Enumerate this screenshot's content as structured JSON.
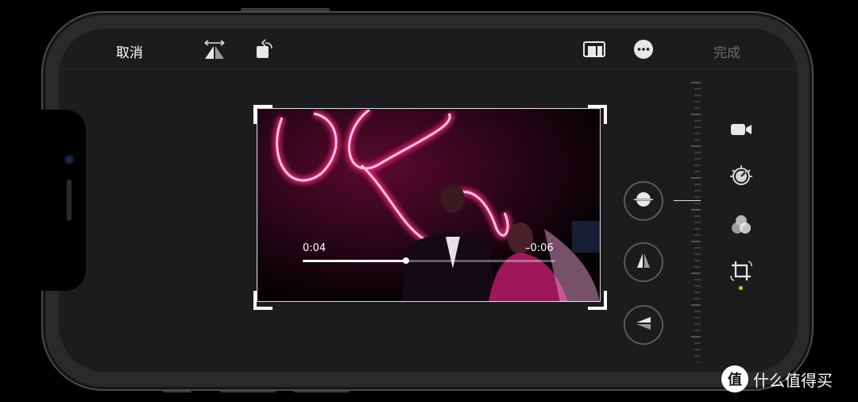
{
  "toolbar": {
    "cancel_label": "取消",
    "done_label": "完成",
    "icons": [
      "flip-horizontal-icon",
      "rotate-icon",
      "aspect-ratio-icon",
      "more-icon"
    ]
  },
  "video": {
    "elapsed": "0:04",
    "remaining": "–0:06",
    "progress": 0.41
  },
  "adjust_buttons": [
    "straighten-icon",
    "vertical-perspective-icon",
    "horizontal-perspective-icon"
  ],
  "side_tools": [
    "video-camera-icon",
    "adjust-dial-icon",
    "filters-icon",
    "crop-rotate-icon"
  ],
  "colors": {
    "accent_active": "#f2c200",
    "done_disabled": "#6b6b6e"
  },
  "watermark": {
    "logo": "值",
    "text": "什么值得买"
  }
}
